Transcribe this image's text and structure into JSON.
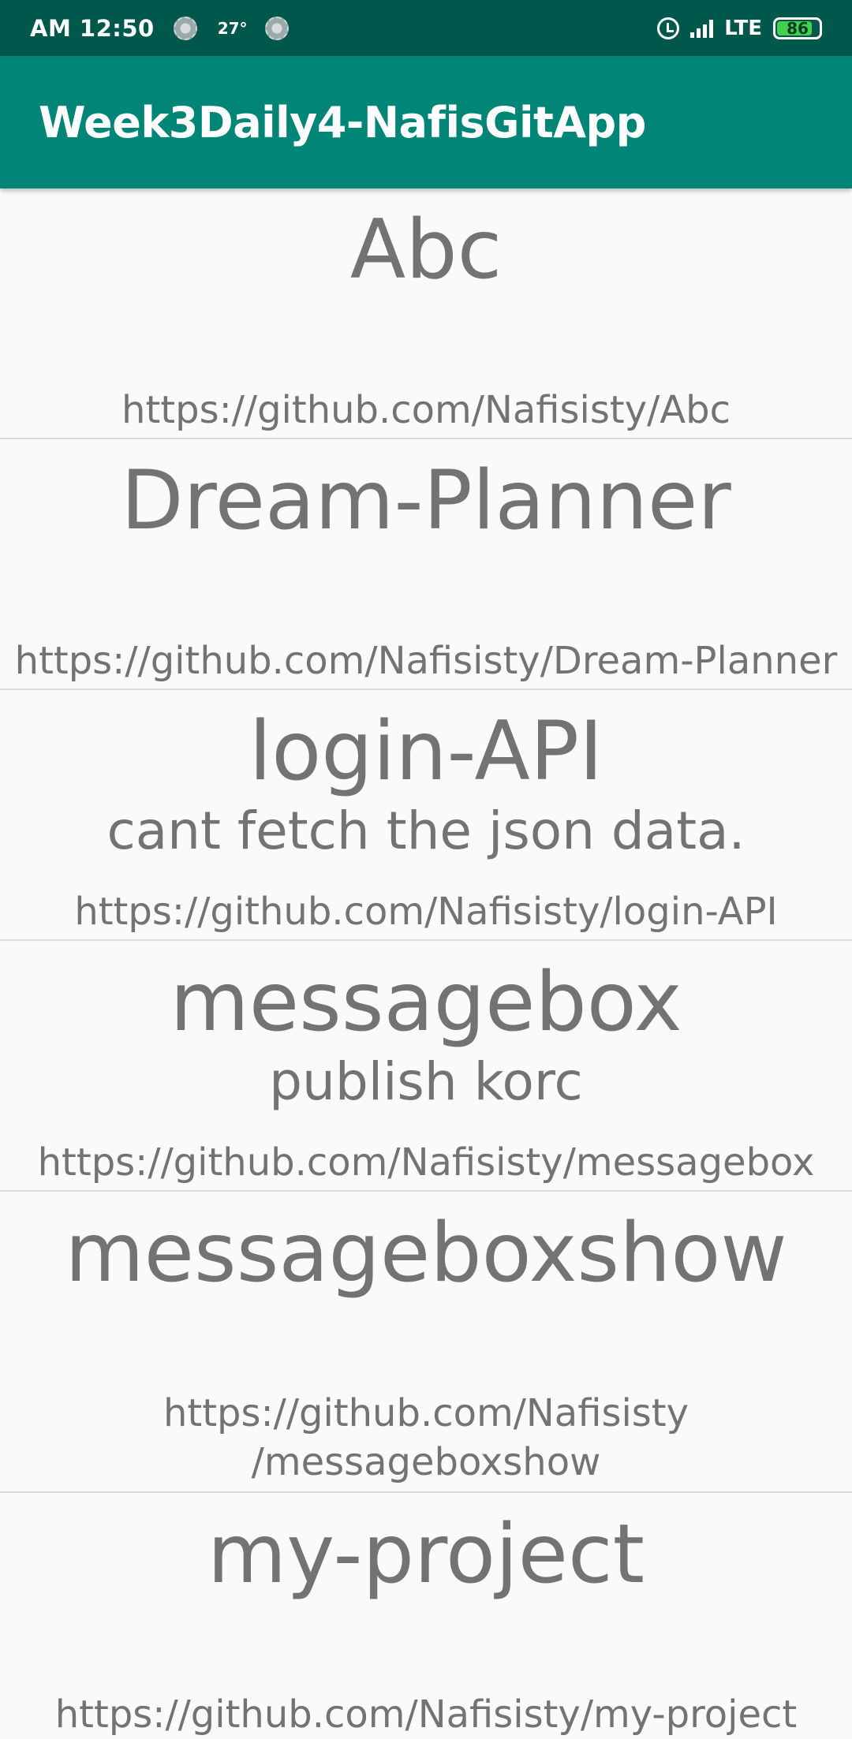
{
  "status_bar": {
    "time": "AM 12:50",
    "temperature": "27°",
    "network": "LTE",
    "battery": "86",
    "battery_level_percent": 86,
    "icons": [
      "weather-icon",
      "weather-icon",
      "alarm-icon",
      "signal-icon",
      "battery-icon"
    ]
  },
  "app_bar": {
    "title": "Week3Daily4-NafisGitApp"
  },
  "repos": [
    {
      "name": "Abc",
      "description": "",
      "url": "https://github.com/Nafisisty/Abc"
    },
    {
      "name": "Dream-Planner",
      "description": "",
      "url": "https://github.com/Nafisisty/Dream-Planner"
    },
    {
      "name": "login-API",
      "description": "cant fetch the json data.",
      "url": "https://github.com/Nafisisty/login-API"
    },
    {
      "name": "messagebox",
      "description": "publish korc",
      "url": "https://github.com/Nafisisty/messagebox"
    },
    {
      "name": "messageboxshow",
      "description": "",
      "url": "https://github.com/Nafisisty\n/messageboxshow"
    },
    {
      "name": "my-project",
      "description": "",
      "url": "https://github.com/Nafisisty/my-project"
    }
  ],
  "colors": {
    "status_bar": "#00574b",
    "app_bar": "#008577",
    "text": "#737373",
    "divider": "#dcdcdc",
    "background": "#fafafa"
  }
}
